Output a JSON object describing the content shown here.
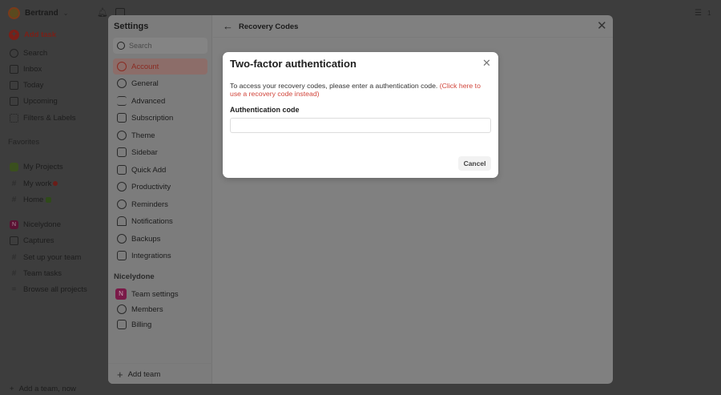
{
  "user": {
    "name": "Bertrand"
  },
  "topbar": {
    "count": "1"
  },
  "sidebar": {
    "add_task": "Add task",
    "nav": [
      {
        "label": "Search"
      },
      {
        "label": "Inbox"
      },
      {
        "label": "Today"
      },
      {
        "label": "Upcoming"
      },
      {
        "label": "Filters & Labels"
      }
    ],
    "favorites_label": "Favorites",
    "favorites": [
      {
        "label": "My Projects"
      },
      {
        "label": "My work"
      },
      {
        "label": "Home"
      }
    ],
    "team": {
      "initial": "N",
      "label": "Nicelydone"
    },
    "team_items": [
      {
        "label": "Captures"
      },
      {
        "label": "Set up your team"
      },
      {
        "label": "Team tasks"
      },
      {
        "label": "Browse all projects"
      }
    ],
    "bottom": "Add a team, now"
  },
  "settings": {
    "title": "Settings",
    "search_placeholder": "Search",
    "items": [
      {
        "label": "Account"
      },
      {
        "label": "General"
      },
      {
        "label": "Advanced"
      },
      {
        "label": "Subscription"
      },
      {
        "label": "Theme"
      },
      {
        "label": "Sidebar"
      },
      {
        "label": "Quick Add"
      },
      {
        "label": "Productivity"
      },
      {
        "label": "Reminders"
      },
      {
        "label": "Notifications"
      },
      {
        "label": "Backups"
      },
      {
        "label": "Integrations"
      }
    ],
    "team_section": "Nicelydone",
    "team_initial": "N",
    "team_items": [
      {
        "label": "Team settings"
      },
      {
        "label": "Members"
      },
      {
        "label": "Billing"
      }
    ],
    "add_team": "Add team",
    "page_title": "Recovery Codes"
  },
  "dialog": {
    "title": "Two-factor authentication",
    "text": "To access your recovery codes, please enter a authentication code. ",
    "link": "(Click here to use a recovery code instead)",
    "field_label": "Authentication code",
    "field_value": "",
    "cancel": "Cancel"
  },
  "colors": {
    "accent": "#dc4c3e",
    "team": "#a01e5a",
    "project": "#5b8a2a"
  }
}
